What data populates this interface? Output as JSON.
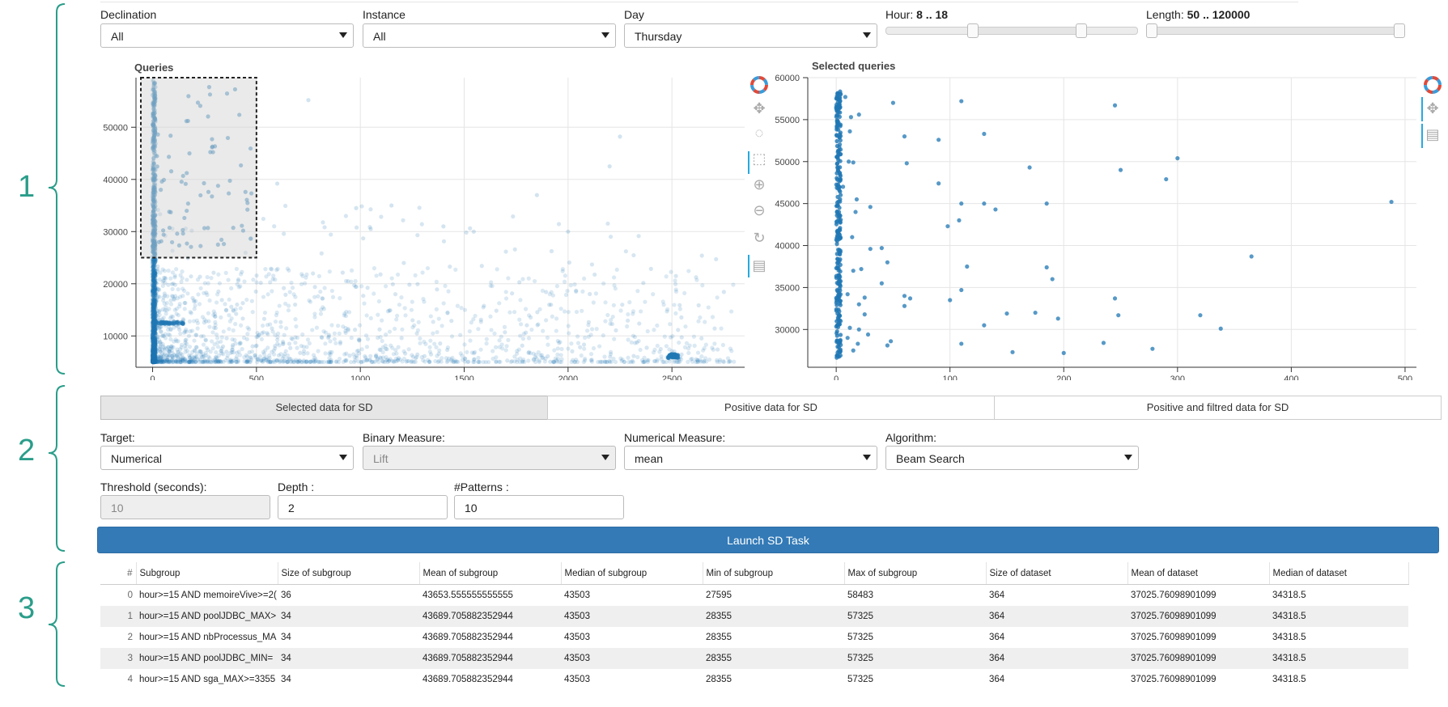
{
  "sections": {
    "one": "1",
    "two": "2",
    "three": "3"
  },
  "filters": {
    "declination": {
      "label": "Declination",
      "value": "All"
    },
    "instance": {
      "label": "Instance",
      "value": "All"
    },
    "day": {
      "label": "Day",
      "value": "Thursday"
    },
    "hour": {
      "label": "Hour: ",
      "value": "8 .. 18",
      "low": 8,
      "high": 18
    },
    "length": {
      "label": "Length: ",
      "value": "50 .. 120000",
      "low": 50,
      "high": 120000
    }
  },
  "plots": {
    "queries": {
      "title": "Queries"
    },
    "selected": {
      "title": "Selected queries"
    },
    "toolbar": {
      "logo_icon": "bokeh-logo-icon",
      "icons": [
        "pan-icon",
        "lasso-select-icon",
        "box-select-icon",
        "zoom-in-icon",
        "zoom-out-icon",
        "reset-icon",
        "hover-icon"
      ]
    }
  },
  "chart_data": [
    {
      "type": "scatter",
      "title": "Queries",
      "xlabel": "",
      "ylabel": "",
      "xlim": [
        -80,
        2850
      ],
      "ylim": [
        4000,
        59500
      ],
      "xticks": [
        0,
        500,
        1000,
        1500,
        2000,
        2500
      ],
      "yticks": [
        10000,
        20000,
        30000,
        40000,
        50000
      ],
      "grid": true,
      "color": "#1f77b4",
      "selection_box": {
        "x": [
          -80,
          500
        ],
        "y": [
          25000,
          59500
        ]
      }
    },
    {
      "type": "scatter",
      "title": "Selected queries",
      "xlabel": "",
      "ylabel": "",
      "xlim": [
        -25,
        510
      ],
      "ylim": [
        25500,
        60000
      ],
      "xticks": [
        0,
        100,
        200,
        300,
        400,
        500
      ],
      "yticks": [
        30000,
        35000,
        40000,
        45000,
        50000,
        55000,
        60000
      ],
      "grid": true,
      "color": "#1f77b4",
      "points": [
        [
          50,
          57000
        ],
        [
          110,
          57200
        ],
        [
          245,
          56700
        ],
        [
          130,
          53300
        ],
        [
          60,
          53000
        ],
        [
          90,
          52600
        ],
        [
          170,
          49300
        ],
        [
          250,
          49000
        ],
        [
          300,
          50400
        ],
        [
          290,
          47900
        ],
        [
          90,
          47400
        ],
        [
          62,
          49800
        ],
        [
          110,
          45000
        ],
        [
          130,
          45000
        ],
        [
          185,
          45000
        ],
        [
          488,
          45200
        ],
        [
          140,
          44300
        ],
        [
          30,
          44600
        ],
        [
          98,
          42300
        ],
        [
          108,
          43000
        ],
        [
          40,
          39700
        ],
        [
          45,
          38000
        ],
        [
          365,
          38700
        ],
        [
          115,
          37500
        ],
        [
          185,
          37400
        ],
        [
          190,
          36000
        ],
        [
          40,
          35500
        ],
        [
          110,
          34700
        ],
        [
          60,
          34000
        ],
        [
          65,
          33700
        ],
        [
          100,
          33500
        ],
        [
          245,
          33700
        ],
        [
          20,
          33000
        ],
        [
          60,
          32800
        ],
        [
          150,
          31900
        ],
        [
          175,
          32000
        ],
        [
          195,
          31300
        ],
        [
          248,
          31700
        ],
        [
          320,
          31700
        ],
        [
          130,
          30500
        ],
        [
          338,
          30100
        ],
        [
          20,
          30000
        ],
        [
          48,
          28600
        ],
        [
          45,
          28100
        ],
        [
          110,
          28300
        ],
        [
          235,
          28400
        ],
        [
          278,
          27700
        ],
        [
          155,
          27300
        ],
        [
          200,
          27200
        ],
        [
          10,
          29000
        ],
        [
          25,
          31800
        ],
        [
          10,
          34200
        ],
        [
          15,
          37000
        ],
        [
          14,
          41000
        ],
        [
          18,
          45500
        ],
        [
          15,
          49900
        ],
        [
          12,
          53600
        ],
        [
          13,
          55300
        ],
        [
          20,
          55600
        ],
        [
          11,
          50000
        ],
        [
          17,
          44000
        ],
        [
          25,
          33800
        ],
        [
          12,
          30200
        ],
        [
          15,
          27500
        ],
        [
          19,
          28300
        ],
        [
          28,
          29400
        ],
        [
          22,
          37200
        ],
        [
          30,
          39600
        ],
        [
          8,
          57700
        ],
        [
          6,
          47000
        ]
      ]
    }
  ],
  "tabs": [
    "Selected data for SD",
    "Positive data for SD",
    "Positive and filtred data for SD"
  ],
  "form": {
    "target": {
      "label": "Target:",
      "value": "Numerical"
    },
    "binary": {
      "label": "Binary Measure:",
      "value": "Lift"
    },
    "numerical": {
      "label": "Numerical Measure:",
      "value": "mean"
    },
    "algorithm": {
      "label": "Algorithm:",
      "value": "Beam Search"
    },
    "threshold": {
      "label": "Threshold (seconds):",
      "value": "10"
    },
    "depth": {
      "label": "Depth :",
      "value": "2"
    },
    "patterns": {
      "label": "#Patterns :",
      "value": "10"
    },
    "launch": "Launch SD Task"
  },
  "table": {
    "columns": [
      "#",
      "Subgroup",
      "Size of subgroup",
      "Mean of subgroup",
      "Median of subgroup",
      "Min of subgroup",
      "Max of subgroup",
      "Size of dataset",
      "Mean of dataset",
      "Median of dataset"
    ],
    "rows": [
      [
        "0",
        "hour>=15 AND memoireVive>=2(",
        "36",
        "43653.555555555555",
        "43503",
        "27595",
        "58483",
        "364",
        "37025.76098901099",
        "34318.5"
      ],
      [
        "1",
        "hour>=15 AND poolJDBC_MAX>",
        "34",
        "43689.705882352944",
        "43503",
        "28355",
        "57325",
        "364",
        "37025.76098901099",
        "34318.5"
      ],
      [
        "2",
        "hour>=15 AND nbProcessus_MA",
        "34",
        "43689.705882352944",
        "43503",
        "28355",
        "57325",
        "364",
        "37025.76098901099",
        "34318.5"
      ],
      [
        "3",
        "hour>=15 AND poolJDBC_MIN=",
        "34",
        "43689.705882352944",
        "43503",
        "28355",
        "57325",
        "364",
        "37025.76098901099",
        "34318.5"
      ],
      [
        "4",
        "hour>=15 AND sga_MAX>=3355",
        "34",
        "43689.705882352944",
        "43503",
        "28355",
        "57325",
        "364",
        "37025.76098901099",
        "34318.5"
      ]
    ]
  }
}
